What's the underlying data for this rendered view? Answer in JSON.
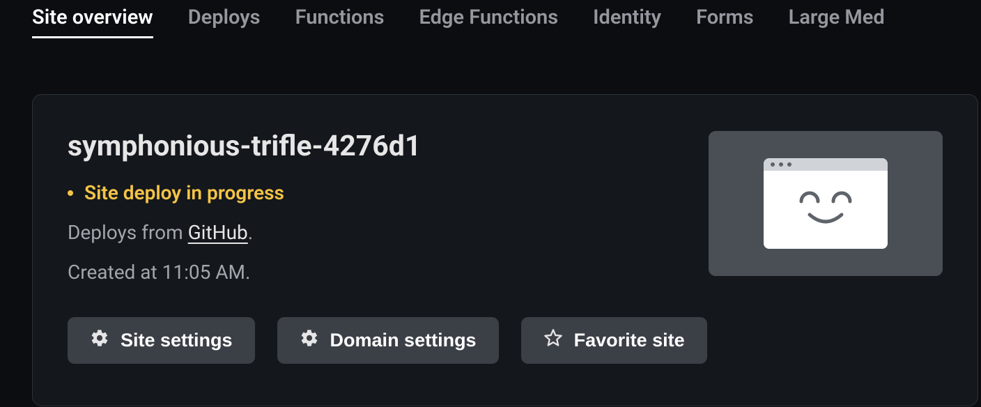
{
  "tabs": [
    {
      "label": "Site overview",
      "active": true
    },
    {
      "label": "Deploys",
      "active": false
    },
    {
      "label": "Functions",
      "active": false
    },
    {
      "label": "Edge Functions",
      "active": false
    },
    {
      "label": "Identity",
      "active": false
    },
    {
      "label": "Forms",
      "active": false
    },
    {
      "label": "Large Med",
      "active": false
    }
  ],
  "site": {
    "name": "symphonious-trifle-4276d1",
    "status": "Site deploy in progress",
    "deploys_from_prefix": "Deploys from ",
    "deploys_from_source": "GitHub",
    "deploys_from_suffix": ".",
    "created_text": "Created at 11:05 AM."
  },
  "buttons": {
    "site_settings": "Site settings",
    "domain_settings": "Domain settings",
    "favorite_site": "Favorite site"
  }
}
